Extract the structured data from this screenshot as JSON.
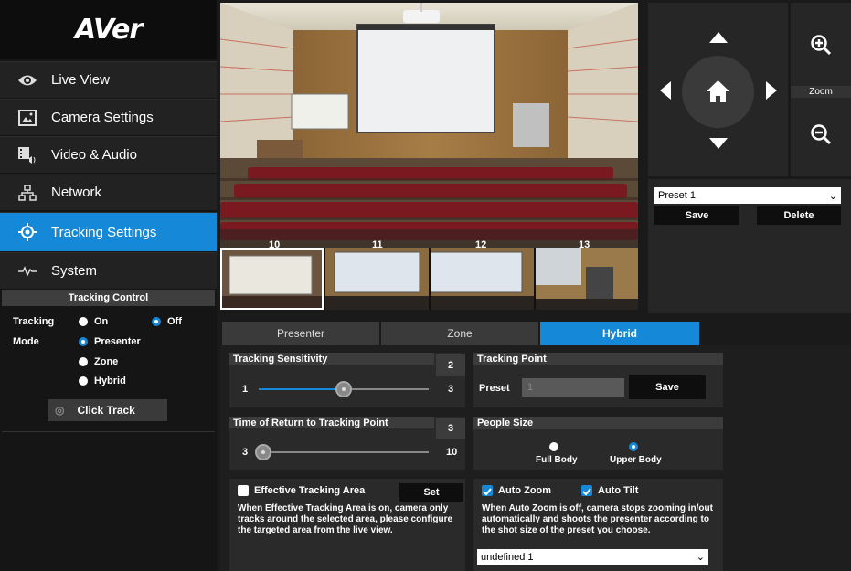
{
  "brand": "AVer",
  "nav": [
    {
      "label": "Live View",
      "icon": "eye-icon"
    },
    {
      "label": "Camera Settings",
      "icon": "image-icon"
    },
    {
      "label": "Video & Audio",
      "icon": "video-audio-icon"
    },
    {
      "label": "Network",
      "icon": "network-icon"
    },
    {
      "label": "Tracking Settings",
      "icon": "crosshair-icon"
    },
    {
      "label": "System",
      "icon": "pulse-icon"
    }
  ],
  "active_nav": "Tracking Settings",
  "tracking_control": {
    "title": "Tracking Control",
    "tracking_label": "Tracking",
    "on_label": "On",
    "off_label": "Off",
    "tracking_selected": "Off",
    "mode_label": "Mode",
    "modes": [
      "Presenter",
      "Zone",
      "Hybrid"
    ],
    "mode_selected": "Presenter",
    "click_track_label": "Click Track"
  },
  "thumbnails": {
    "numbers": [
      "10",
      "11",
      "12",
      "13"
    ]
  },
  "ptz": {
    "zoom_label": "Zoom",
    "preset_selected": "Preset 1",
    "save_label": "Save",
    "delete_label": "Delete"
  },
  "tabs": [
    "Presenter",
    "Zone",
    "Hybrid"
  ],
  "active_tab": "Hybrid",
  "tracking_sensitivity": {
    "title": "Tracking Sensitivity",
    "value": "2",
    "min": "1",
    "max": "3",
    "level": 0.5
  },
  "return_time": {
    "title": "Time of Return to Tracking Point",
    "value": "3",
    "min": "3",
    "max": "10",
    "level": 0.0
  },
  "effective_area": {
    "label": "Effective Tracking Area",
    "checked": false,
    "set_label": "Set",
    "description": "When Effective Tracking Area is on, camera only tracks around the selected area, please configure the targeted area from the live view."
  },
  "tracking_point": {
    "title": "Tracking Point",
    "preset_label": "Preset",
    "preset_value": "1",
    "save_label": "Save"
  },
  "people_size": {
    "title": "People Size",
    "options": [
      "Full Body",
      "Upper Body"
    ],
    "selected": "Upper Body"
  },
  "auto": {
    "auto_zoom_label": "Auto Zoom",
    "auto_zoom_checked": true,
    "auto_tilt_label": "Auto Tilt",
    "auto_tilt_checked": true,
    "description": "When Auto Zoom is off, camera stops zooming in/out automatically and shoots the presenter according to the shot size of the preset you choose.",
    "shot_select": "undefined 1"
  },
  "colors": {
    "accent": "#1688d8",
    "panel": "#262626",
    "background": "#1a1a1a"
  }
}
